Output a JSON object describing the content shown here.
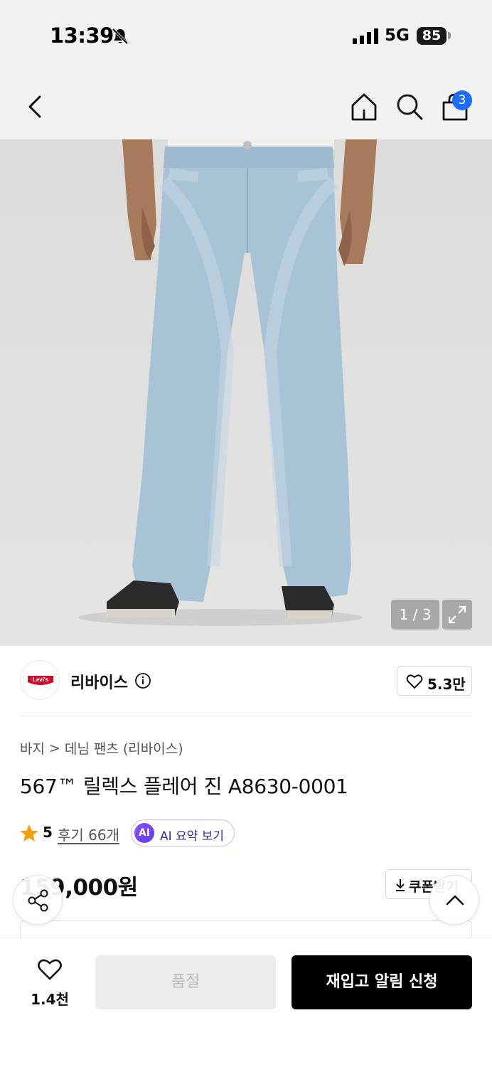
{
  "status_bar": {
    "time": "13:39",
    "network": "5G",
    "battery": "85",
    "icons": [
      "bell-muted-icon",
      "signal-icon",
      "battery-icon"
    ]
  },
  "nav": {
    "icons": [
      "back-icon",
      "home-icon",
      "search-icon",
      "shopping-bag-icon"
    ],
    "cart_badge": "3",
    "badge_color": "#1e6bff"
  },
  "gallery": {
    "counter": "1 / 3",
    "expand_icon": "expand-icon"
  },
  "brand": {
    "logo_text": "Levi's",
    "name": "리바이스",
    "info_icon": "info-icon",
    "likes": "5.3만"
  },
  "breadcrumb": {
    "items": [
      "바지",
      "데님 팬츠 (리바이스)"
    ],
    "separator": ">"
  },
  "product": {
    "title": "567™ 릴렉스 플레어 진 A8630-0001",
    "rating": "5",
    "review_link": "후기 66개",
    "ai_badge": "AI",
    "ai_label": "AI 요약 보기",
    "price": "159,000원",
    "coupon_label": "쿠폰받기"
  },
  "bottom_bar": {
    "wish_count": "1.4천",
    "soldout_label": "품절",
    "restock_label": "재입고 알림 신청"
  },
  "colors": {
    "accent_blue": "#1e6bff",
    "star": "#f59e0b",
    "ai_purple": "#6b46f5",
    "levis_red": "#c8102e"
  }
}
